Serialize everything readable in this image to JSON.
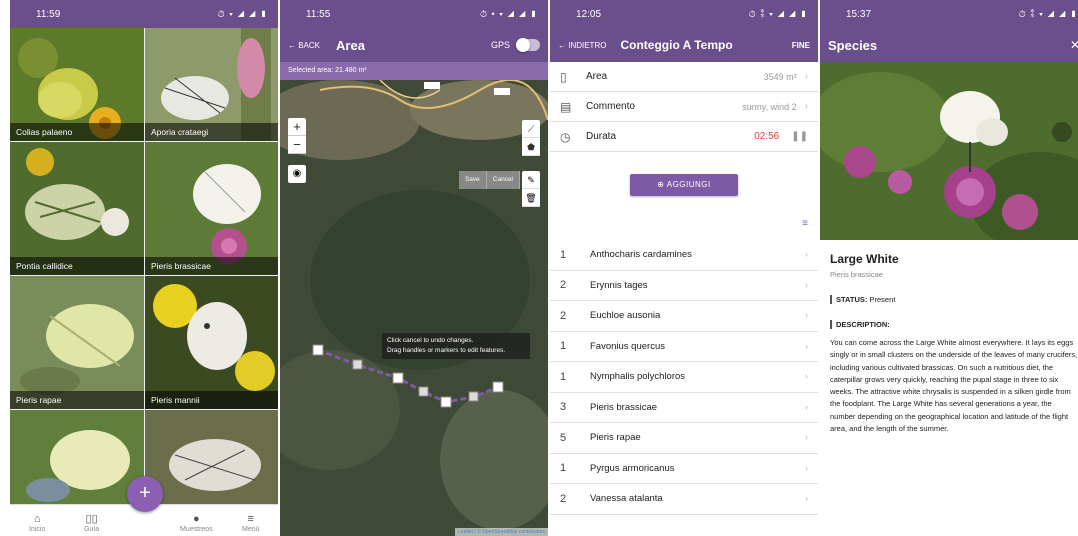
{
  "panel1": {
    "time": "11:59",
    "status_icons": "⏱ ▾ ◢ ◢ ▮",
    "species": [
      "Colias palaeno",
      "Aporia crataegi",
      "Pontia callidice",
      "Pieris brassicae",
      "Pieris rapae",
      "Pieris mannii",
      "",
      ""
    ],
    "nav": {
      "home": "Inicio",
      "guide": "Guía",
      "add": "+",
      "samples": "Muestreos",
      "menu": "Menú"
    }
  },
  "panel2": {
    "time": "11:55",
    "status_icons": "⏱ • ▾ ◢ ◢ ▮",
    "back": "← BACK",
    "title": "Area",
    "gps": "GPS",
    "selected_area": "Selected area: 21.480 m²",
    "zoom_in": "+",
    "zoom_out": "−",
    "save": "Save",
    "cancel": "Cancel",
    "tooltip_line1": "Click cancel to undo changes.",
    "tooltip_line2": "Drag handles or markers to edit features.",
    "attribution": "Leaflet | © OpenStreetMap contributors"
  },
  "panel3": {
    "time": "12:05",
    "status_icons": "⏱ ⁑ ▾ ◢ ◢ ▮",
    "back": "← INDIETRO",
    "title": "Conteggio A Tempo",
    "done": "FINE",
    "area_label": "Area",
    "area_value": "3549 m²",
    "comment_label": "Commento",
    "comment_value": "sunny, wind 2",
    "duration_label": "Durata",
    "duration_value": "02:56",
    "add_button": "⊕  AGGIUNGI",
    "species_counts": [
      {
        "count": "1",
        "name": "Anthocharis cardamines"
      },
      {
        "count": "2",
        "name": "Erynnis tages"
      },
      {
        "count": "2",
        "name": "Euchloe ausonia"
      },
      {
        "count": "1",
        "name": "Favonius quercus"
      },
      {
        "count": "1",
        "name": "Nymphalis polychloros"
      },
      {
        "count": "3",
        "name": "Pieris brassicae"
      },
      {
        "count": "5",
        "name": "Pieris rapae"
      },
      {
        "count": "1",
        "name": "Pyrgus armoricanus"
      },
      {
        "count": "2",
        "name": "Vanessa atalanta"
      }
    ]
  },
  "panel4": {
    "time": "15:37",
    "status_icons": "⏱ ⁑ ▾ ◢ ◢ ▮",
    "title": "Species",
    "close": "✕",
    "name": "Large White",
    "latin": "Pieris brassicae",
    "status_label": "STATUS:",
    "status_value": "Present",
    "description_label": "DESCRIPTION:",
    "description": "You can come across the Large White almost everywhere. It lays its eggs singly or in small clusters on the underside of the leaves of many crucifers, including various cultivated brassicas. On such a nutritious diet, the caterpillar grows very quickly, reaching the pupal stage in three to six weeks. The attractive white chrysalis is suspended in a silken girdle from the foodplant. The Large White has several generations a year, the number depending on the geographical location and latitude of the flight area, and the length of the summer."
  },
  "colors": {
    "primary": "#6b4f8c",
    "accent": "#7e5aa6",
    "timer": "#e53935"
  }
}
